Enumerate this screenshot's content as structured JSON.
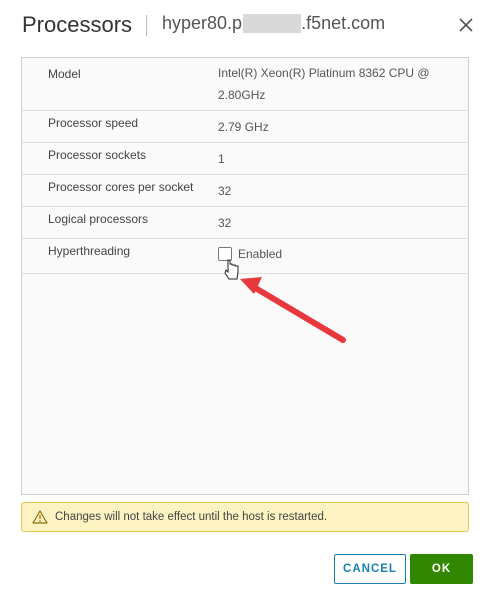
{
  "dialog": {
    "title": "Processors",
    "host_prefix": "hyper80.p",
    "host_suffix": ".f5net.com"
  },
  "properties": [
    {
      "label": "Model",
      "value": "Intel(R) Xeon(R) Platinum 8362 CPU @ 2.80GHz"
    },
    {
      "label": "Processor speed",
      "value": "2.79 GHz"
    },
    {
      "label": "Processor sockets",
      "value": "1"
    },
    {
      "label": "Processor cores per socket",
      "value": "32"
    },
    {
      "label": "Logical processors",
      "value": "32"
    },
    {
      "label": "Hyperthreading",
      "checkbox_label": "Enabled",
      "checked": false
    }
  ],
  "warning": {
    "text": "Changes will not take effect until the host is restarted.",
    "icon": "warning-triangle-icon"
  },
  "buttons": {
    "cancel": "CANCEL",
    "ok": "OK"
  },
  "colors": {
    "accent": "#1a7fb5",
    "ok_button": "#318700",
    "warning_bg": "#fdf3c2",
    "annotation_arrow": "#e8383d"
  }
}
